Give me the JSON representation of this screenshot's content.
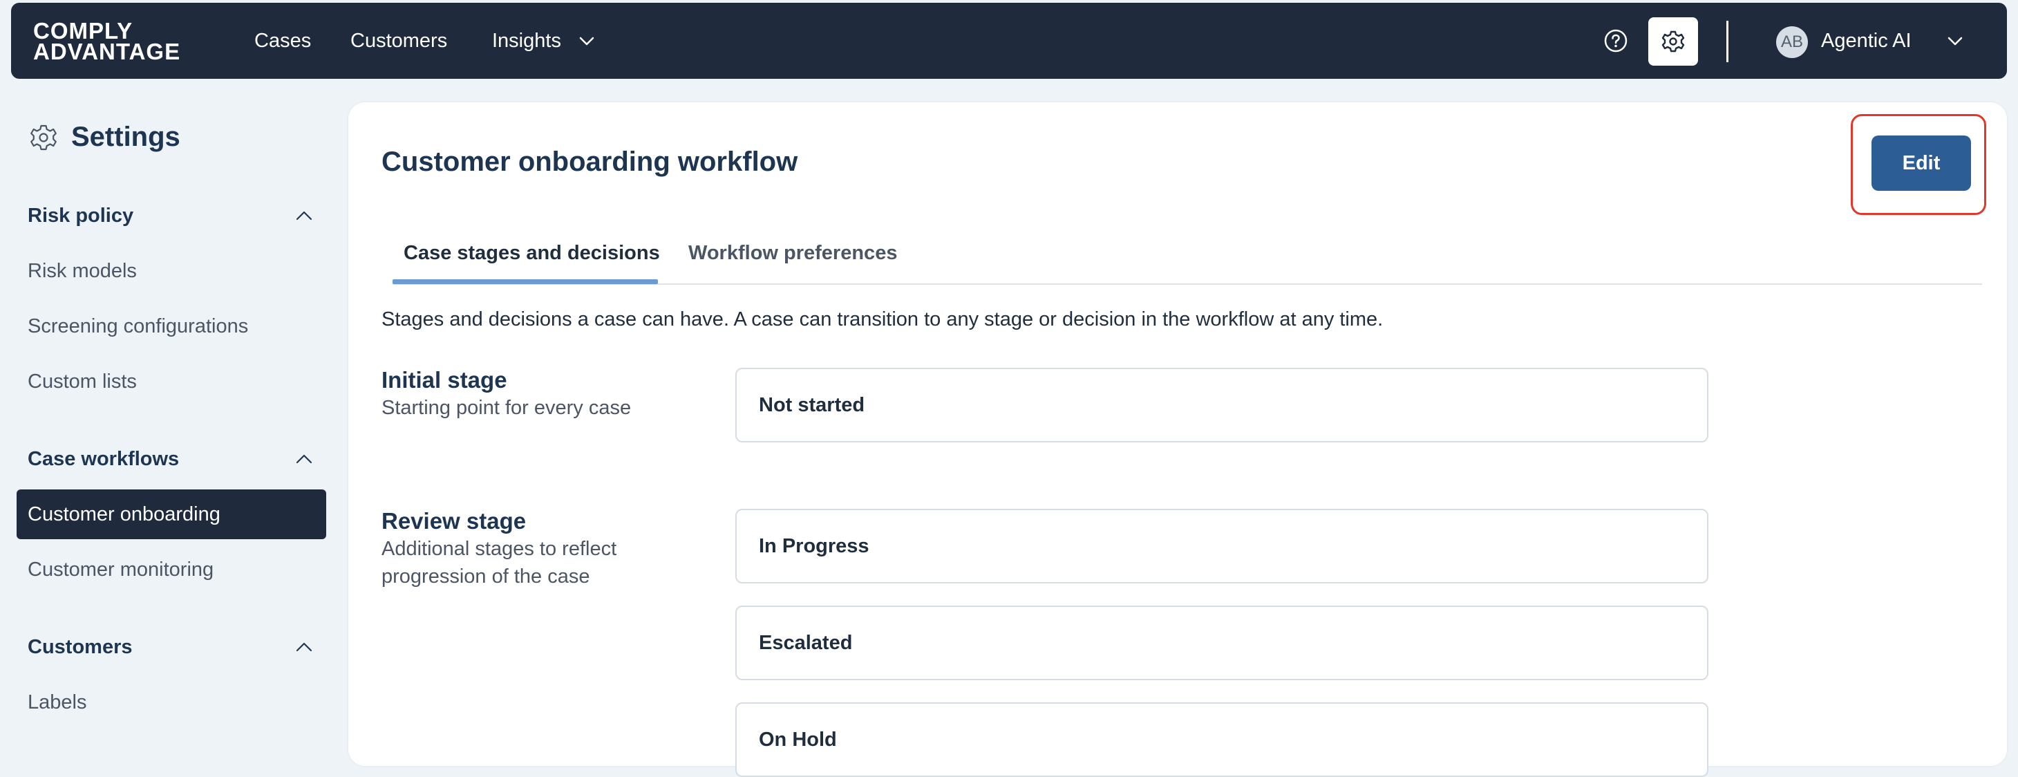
{
  "topbar": {
    "logo_line1": "COMPLY",
    "logo_line2": "ADVANTAGE",
    "nav": {
      "cases": "Cases",
      "customers": "Customers",
      "insights": "Insights"
    },
    "user": {
      "initials": "AB",
      "name": "Agentic AI"
    },
    "icons": [
      "chevron-down-icon",
      "help-icon",
      "gear-icon"
    ]
  },
  "sidebar": {
    "title": "Settings",
    "sections": [
      {
        "label": "Risk policy",
        "expanded": true,
        "items": [
          "Risk models",
          "Screening configurations",
          "Custom lists"
        ]
      },
      {
        "label": "Case workflows",
        "expanded": true,
        "items": [
          "Customer onboarding",
          "Customer monitoring"
        ],
        "active_item": "Customer onboarding"
      },
      {
        "label": "Customers",
        "expanded": true,
        "items": [
          "Labels"
        ]
      }
    ]
  },
  "main": {
    "title": "Customer onboarding workflow",
    "edit_label": "Edit",
    "tabs": [
      {
        "label": "Case stages and decisions",
        "active": true
      },
      {
        "label": "Workflow preferences",
        "active": false
      }
    ],
    "description": "Stages and decisions a case can have. A case can transition to any stage or decision in the workflow at any time.",
    "initial_stage": {
      "label": "Initial stage",
      "sub": "Starting point for every case",
      "values": [
        "Not started"
      ]
    },
    "review_stage": {
      "label": "Review stage",
      "sub": "Additional stages to reflect progression of the case",
      "values": [
        "In Progress",
        "Escalated",
        "On Hold"
      ]
    }
  },
  "colors": {
    "topbar_bg": "#1f2a3c",
    "primary_button": "#2c5d95",
    "highlight": "#e0392b",
    "tab_indicator": "#6b9bd0",
    "page_bg": "#eef3f8"
  }
}
